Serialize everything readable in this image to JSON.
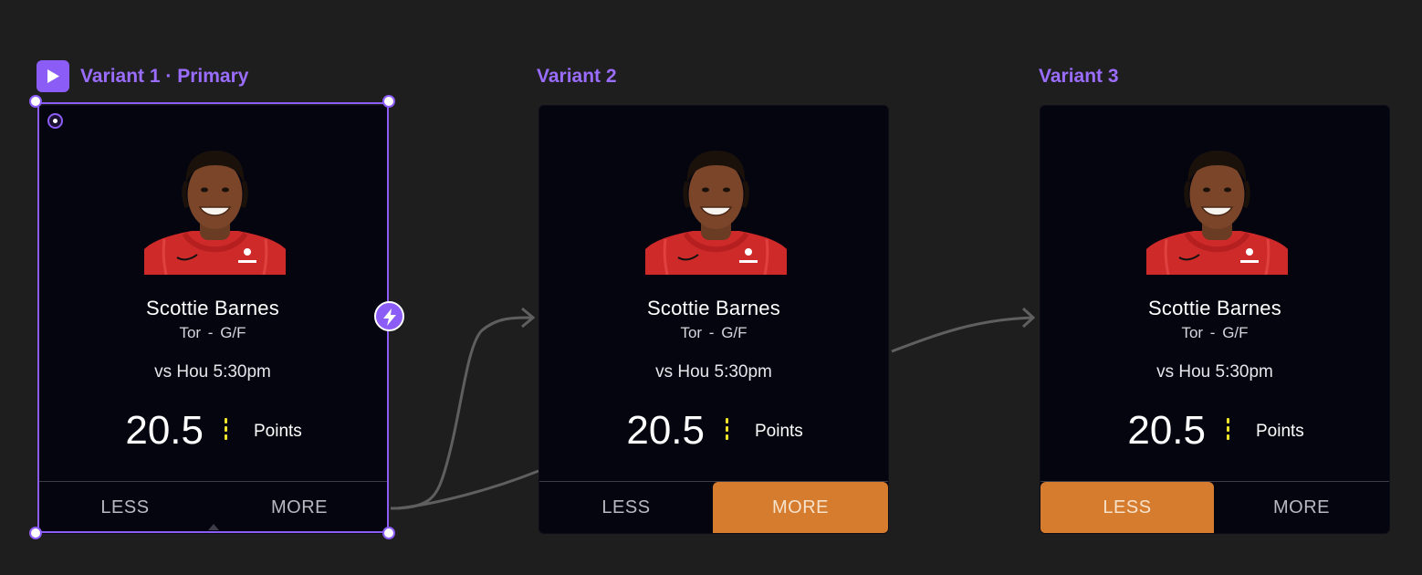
{
  "colors": {
    "accent": "#8b5cf6",
    "label": "#9b6dff",
    "selected_pick": "#d57c2f",
    "card_background": "#050510",
    "canvas_background": "#1e1e1e",
    "divider": "#f2e32b"
  },
  "variants": [
    {
      "title": "Variant 1 · Primary",
      "card": {
        "player_name": "Scottie Barnes",
        "team_position": "Tor - G/F",
        "game_time": "vs Hou 5:30pm",
        "line_value": "20.5",
        "stat_label": "Points",
        "less_label": "LESS",
        "more_label": "MORE",
        "selected": "none"
      }
    },
    {
      "title": "Variant 2",
      "card": {
        "player_name": "Scottie Barnes",
        "team_position": "Tor - G/F",
        "game_time": "vs Hou 5:30pm",
        "line_value": "20.5",
        "stat_label": "Points",
        "less_label": "LESS",
        "more_label": "MORE",
        "selected": "more"
      }
    },
    {
      "title": "Variant 3",
      "card": {
        "player_name": "Scottie Barnes",
        "team_position": "Tor - G/F",
        "game_time": "vs Hou 5:30pm",
        "line_value": "20.5",
        "stat_label": "Points",
        "less_label": "LESS",
        "more_label": "MORE",
        "selected": "less"
      }
    }
  ],
  "icons": {
    "play": "play-icon",
    "bolt": "lightning-bolt-icon",
    "anchor": "anchor-point-icon"
  }
}
